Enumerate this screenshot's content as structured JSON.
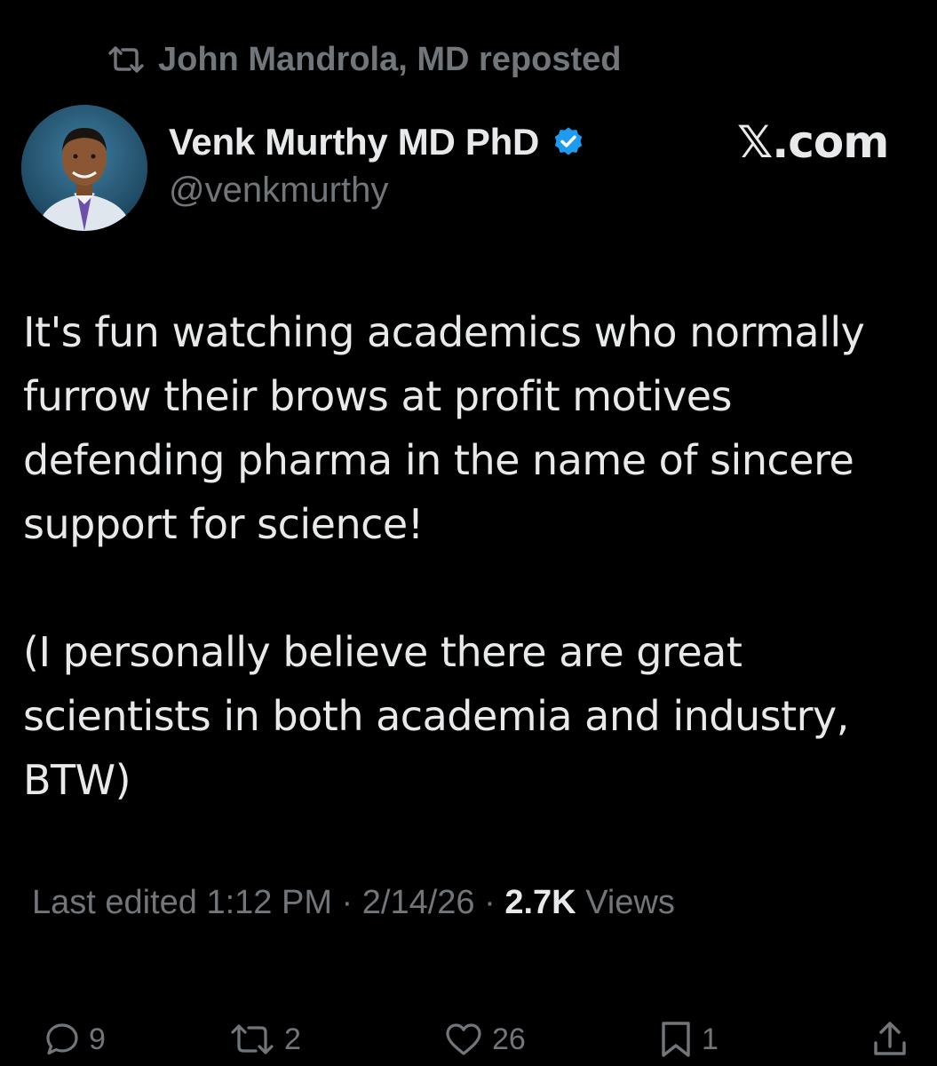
{
  "repost": {
    "icon": "repost-icon",
    "text": "John Mandrola, MD reposted"
  },
  "author": {
    "name": "Venk Murthy MD PhD",
    "handle": "@venkmurthy",
    "verified_icon": "verified-badge-icon",
    "verified_color": "#1d9bf0"
  },
  "site_label": "𝕏.com",
  "tweet": {
    "paragraphs": [
      "It's fun watching academics who normally furrow their brows at profit motives defending pharma in the name of sincere support for science!",
      "(I personally believe there are great scientists in both academia and industry, BTW)"
    ]
  },
  "meta": {
    "edited_label": "Last edited 1:12 PM",
    "separator": " · ",
    "date": "2/14/26",
    "separator2": " · ",
    "views_count": "2.7K",
    "views_label": " Views"
  },
  "actions": {
    "reply": {
      "icon": "reply-icon",
      "count": "9"
    },
    "repost": {
      "icon": "repost-icon",
      "count": "2"
    },
    "like": {
      "icon": "heart-icon",
      "count": "26"
    },
    "bookmark": {
      "icon": "bookmark-icon",
      "count": "1"
    },
    "share": {
      "icon": "share-icon"
    }
  },
  "colors": {
    "background": "#000000",
    "text_primary": "#e7e9ea",
    "text_secondary": "#71767b",
    "accent": "#1d9bf0"
  }
}
